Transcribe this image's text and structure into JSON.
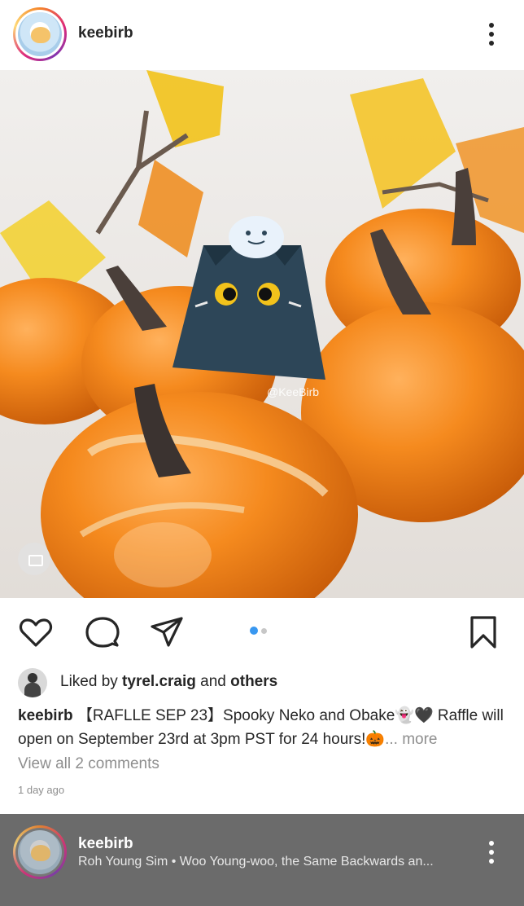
{
  "post": {
    "username": "keebirb",
    "watermark": "@KeeBirb",
    "carousel": {
      "count": 2,
      "active": 0,
      "active_color": "#3897f0",
      "inactive_color": "#c7c7c7"
    },
    "likes": {
      "prefix": "Liked by ",
      "user": "tyrel.craig",
      "middle": " and ",
      "others": "others"
    },
    "caption": {
      "username": "keebirb",
      "text": " 【RAFLLE SEP 23】Spooky Neko and Obake👻🖤 Raffle will open on September 23rd at 3pm PST for 24 hours!🎃",
      "more": "... more"
    },
    "comments_link": "View all 2 comments",
    "time_ago": "1 day ago",
    "icons": [
      "heart-icon",
      "comment-icon",
      "share-icon",
      "bookmark-icon",
      "more-vert-icon"
    ]
  },
  "next_post": {
    "username": "keebirb",
    "audio": "Roh Young Sim • Woo Young-woo, the Same Backwards an..."
  }
}
